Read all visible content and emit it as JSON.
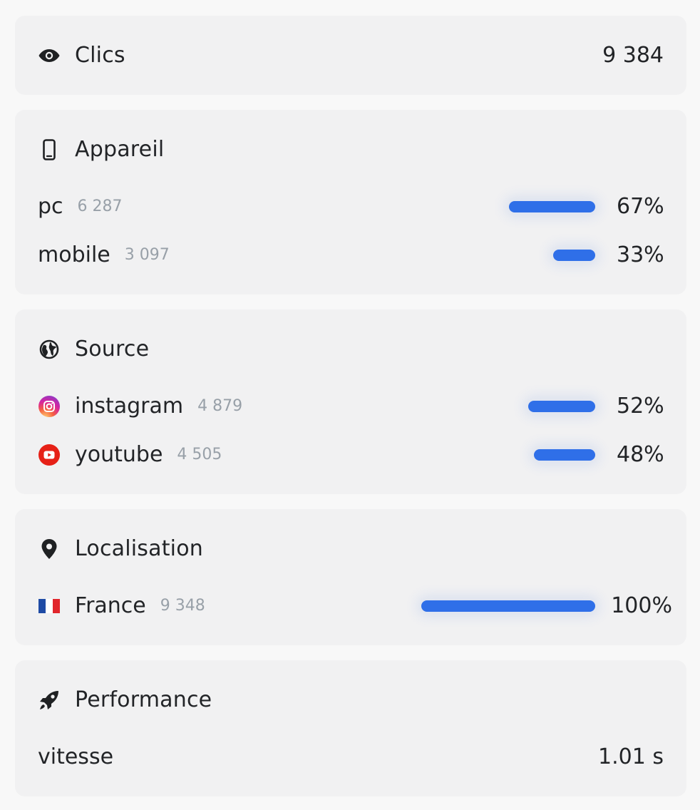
{
  "clics": {
    "title": "Clics",
    "value": "9 384",
    "icon": "eye-icon"
  },
  "device": {
    "title": "Appareil",
    "icon": "phone-icon",
    "items": [
      {
        "label": "pc",
        "count": "6 287",
        "pct": "67%",
        "fraction": 0.67
      },
      {
        "label": "mobile",
        "count": "3 097",
        "pct": "33%",
        "fraction": 0.33
      }
    ]
  },
  "source": {
    "title": "Source",
    "icon": "globe-icon",
    "items": [
      {
        "label": "instagram",
        "count": "4 879",
        "pct": "52%",
        "fraction": 0.52,
        "icon": "instagram-icon"
      },
      {
        "label": "youtube",
        "count": "4 505",
        "pct": "48%",
        "fraction": 0.48,
        "icon": "youtube-icon"
      }
    ]
  },
  "location": {
    "title": "Localisation",
    "icon": "location-pin-icon",
    "items": [
      {
        "label": "France",
        "count": "9 348",
        "pct": "100%",
        "fraction": 1.0,
        "icon": "france-flag-icon"
      }
    ]
  },
  "performance": {
    "title": "Performance",
    "icon": "rocket-icon",
    "metric_label": "vitesse",
    "metric_value": "1.01 s"
  },
  "colors": {
    "bar": "#2f6fe8",
    "card": "#f1f1f2",
    "muted_text": "#98a0a8",
    "text": "#222427",
    "instagram": "#d6249f",
    "youtube": "#e62117"
  }
}
